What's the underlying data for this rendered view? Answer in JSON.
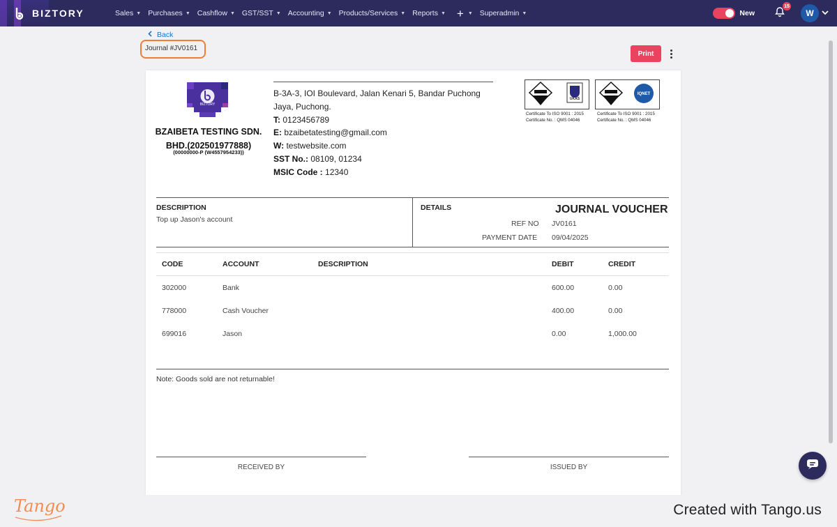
{
  "app": {
    "brand": "BIZTORY"
  },
  "nav": {
    "items": [
      {
        "label": "Sales"
      },
      {
        "label": "Purchases"
      },
      {
        "label": "Cashflow"
      },
      {
        "label": "GST/SST"
      },
      {
        "label": "Accounting"
      },
      {
        "label": "Products/Services"
      },
      {
        "label": "Reports"
      }
    ],
    "plus_icon": "plus-icon",
    "superadmin": "Superadmin",
    "toggle_label": "New",
    "notification_count": "15",
    "avatar_initial": "W"
  },
  "page": {
    "back_label": "Back",
    "title": "Journal #JV0161",
    "print_label": "Print"
  },
  "company": {
    "logo_caption": "BIZTORY",
    "name_line1": "BZAIBETA TESTING SDN.",
    "name_line2": "BHD.(202501977888)",
    "reg": "(00000000-P (W4557954233))",
    "address": "B-3A-3, IOI Boulevard, Jalan Kenari 5, Bandar Puchong Jaya, Puchong.",
    "phone_label": "T:",
    "phone": "0123456789",
    "email_label": "E:",
    "email": "bzaibetatesting@gmail.com",
    "web_label": "W:",
    "web": "testwebsite.com",
    "sst_label": "SST No.:",
    "sst": "08109, 01234",
    "msic_label": "MSIC Code :",
    "msic": "12340"
  },
  "certs": [
    {
      "line1": "Certificate To ISO 9001 : 2015",
      "line2": "Certificate No. : QMS 04046",
      "badge": "UKAS"
    },
    {
      "line1": "Certificate To ISO 9001 : 2015",
      "line2": "Certificate No. : QMS 04046",
      "badge": "IQNET"
    }
  ],
  "voucher": {
    "description_label": "DESCRIPTION",
    "description": "Top up Jason's account",
    "details_label": "DETAILS",
    "doc_title": "JOURNAL VOUCHER",
    "ref_label": "REF NO",
    "ref": "JV0161",
    "date_label": "PAYMENT DATE",
    "date": "09/04/2025"
  },
  "table": {
    "headers": {
      "code": "CODE",
      "account": "ACCOUNT",
      "description": "DESCRIPTION",
      "debit": "DEBIT",
      "credit": "CREDIT"
    },
    "rows": [
      {
        "code": "302000",
        "account": "Bank",
        "description": "",
        "debit": "600.00",
        "credit": "0.00"
      },
      {
        "code": "778000",
        "account": "Cash Voucher",
        "description": "",
        "debit": "400.00",
        "credit": "0.00"
      },
      {
        "code": "699016",
        "account": "Jason",
        "description": "",
        "debit": "0.00",
        "credit": "1,000.00"
      }
    ]
  },
  "note": "Note: Goods sold are not returnable!",
  "signatures": {
    "received": "RECEIVED BY",
    "issued": "ISSUED BY"
  },
  "footer": {
    "logo": "Tango",
    "created": "Created with Tango.us"
  }
}
